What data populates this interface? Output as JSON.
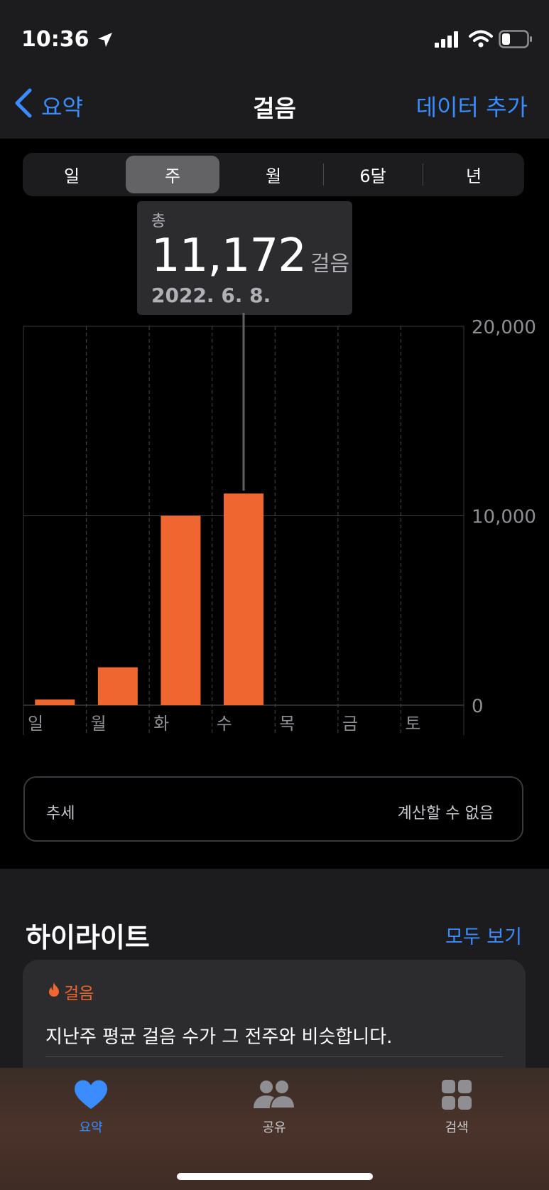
{
  "status": {
    "time": "10:36"
  },
  "nav": {
    "back_label": "요약",
    "title": "걸음",
    "add_label": "데이터 추가"
  },
  "segments": {
    "items": [
      "일",
      "주",
      "월",
      "6달",
      "년"
    ],
    "selected": "주"
  },
  "tooltip": {
    "label": "총",
    "value": "11,172",
    "unit": "걸음",
    "date": "2022. 6. 8."
  },
  "chart_data": {
    "type": "bar",
    "categories": [
      "일",
      "월",
      "화",
      "수",
      "목",
      "금",
      "토"
    ],
    "values": [
      300,
      2000,
      10000,
      11172,
      0,
      0,
      0
    ],
    "ylim": [
      0,
      20000
    ],
    "y_ticks": [
      "0",
      "10,000",
      "20,000"
    ],
    "bar_color": "#ef6630",
    "selected_category": "수"
  },
  "trend": {
    "label": "추세",
    "value": "계산할 수 없음"
  },
  "highlights": {
    "title": "하이라이트",
    "see_all": "모두 보기",
    "card": {
      "category": "걸음",
      "text": "지난주 평균 걸음 수가 그 전주와 비슷합니다."
    }
  },
  "tabs": [
    {
      "label": "요약",
      "icon": "heart-icon",
      "active": true
    },
    {
      "label": "공유",
      "icon": "people-icon",
      "active": false
    },
    {
      "label": "검색",
      "icon": "grid-icon",
      "active": false
    }
  ],
  "colors": {
    "accent": "#3a8cff",
    "orange": "#ef6630"
  }
}
